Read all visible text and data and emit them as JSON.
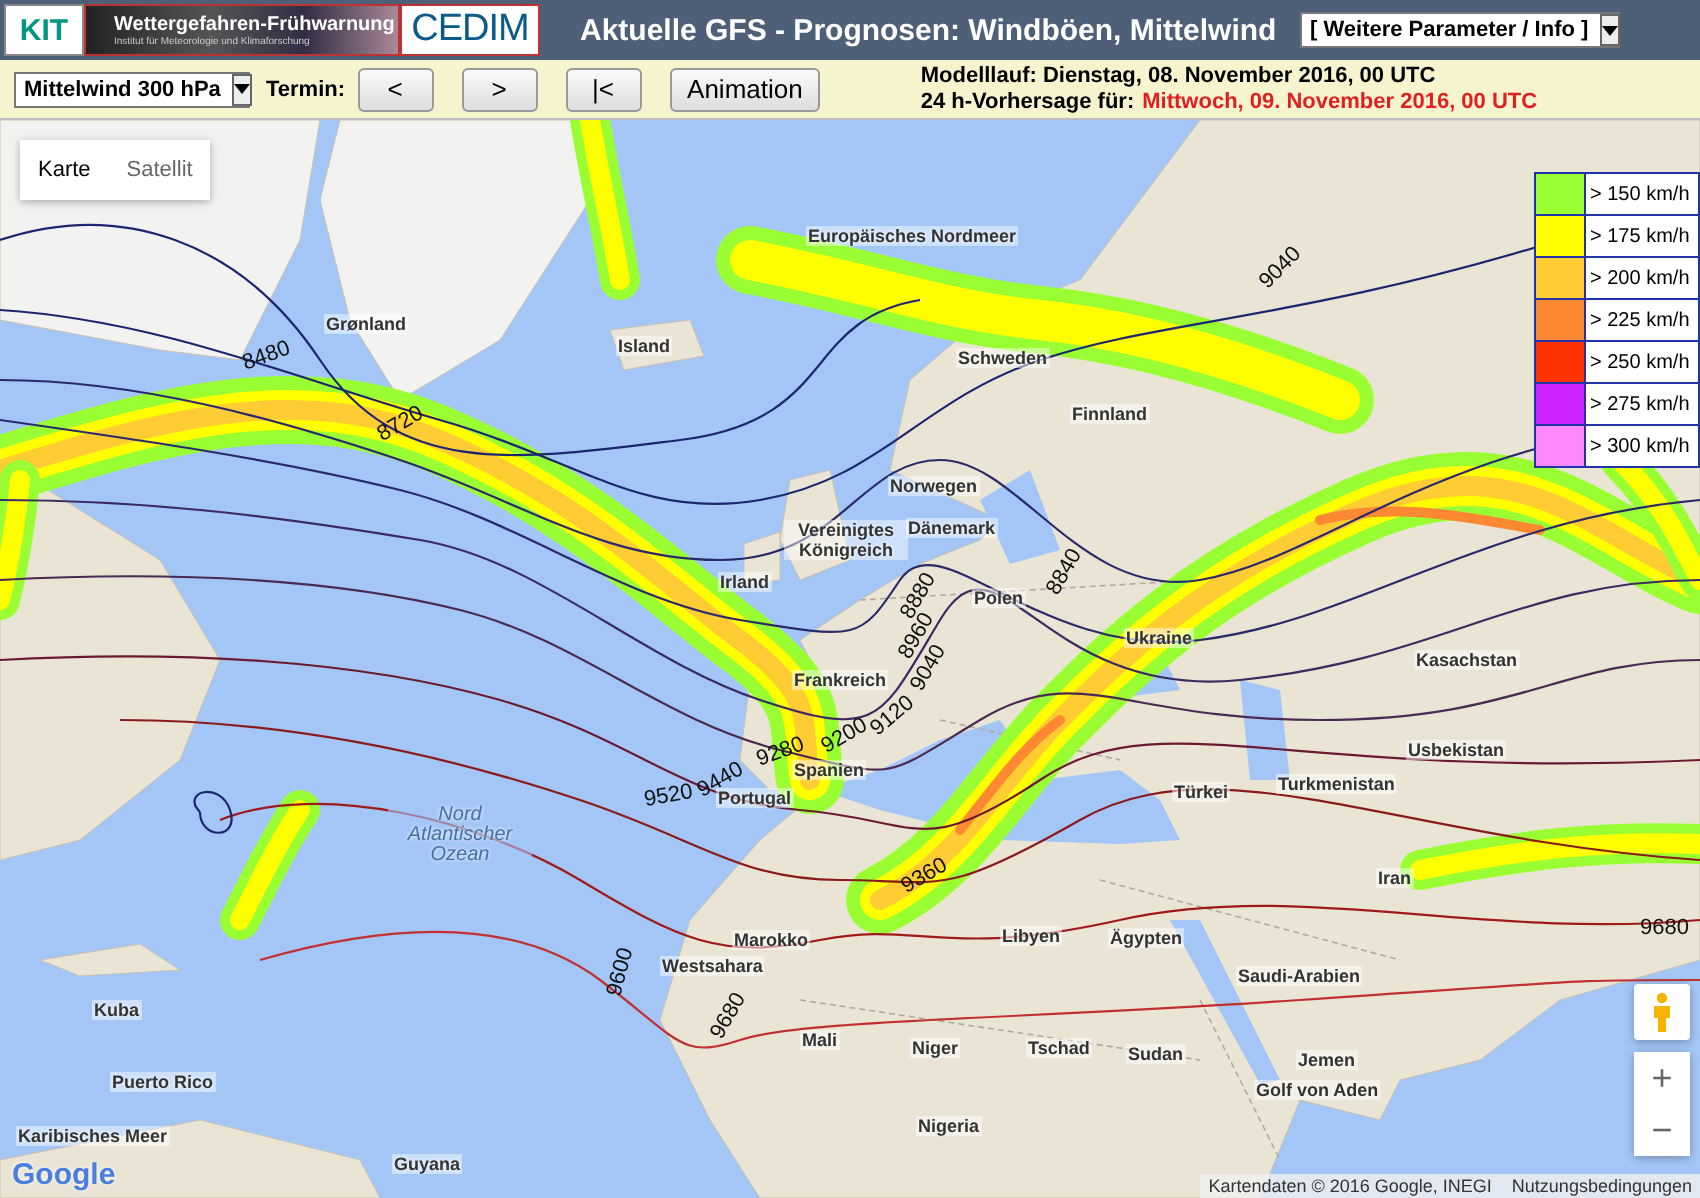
{
  "header": {
    "logo": "KIT",
    "banner_title": "Wettergefahren-Frühwarnung",
    "banner_subtitle": "Institut für Meteorologie und Klimaforschung",
    "partner_logo": "CEDIM",
    "title": "Aktuelle GFS - Prognosen: Windböen, Mittelwind",
    "parameter_select": "[ Weitere Parameter / Info ]"
  },
  "toolbar": {
    "level_select": "Mittelwind 300 hPa",
    "termin_label": "Termin:",
    "buttons": [
      "<",
      ">",
      "|<",
      "Animation"
    ],
    "model_run": "Modelllauf: Dienstag, 08. November 2016, 00 UTC",
    "forecast_label": "24 h-Vorhersage für:",
    "forecast_date": "Mittwoch, 09. November 2016, 00 UTC"
  },
  "map": {
    "map_types": [
      {
        "label": "Karte",
        "selected": true
      },
      {
        "label": "Satellit",
        "selected": false
      }
    ],
    "legend": [
      {
        "label": "> 150 km/h",
        "color": "#99ff33"
      },
      {
        "label": "> 175 km/h",
        "color": "#ffff00"
      },
      {
        "label": "> 200 km/h",
        "color": "#ffcc33"
      },
      {
        "label": "> 225 km/h",
        "color": "#ff8833"
      },
      {
        "label": "> 250 km/h",
        "color": "#ff3300"
      },
      {
        "label": "> 275 km/h",
        "color": "#cc22ff"
      },
      {
        "label": "> 300 km/h",
        "color": "#ff88ff"
      }
    ],
    "place_labels": [
      "Grønland",
      "Island",
      "Europäisches Nordmeer",
      "Schweden",
      "Finnland",
      "Norwegen",
      "Dänemark",
      "Vereinigtes Königreich",
      "Irland",
      "Polen",
      "Ukraine",
      "Kasachstan",
      "Frankreich",
      "Spanien",
      "Portugal",
      "Marokko",
      "Libyen",
      "Ägypten",
      "Türkei",
      "Turkmenistan",
      "Usbekistan",
      "Iran",
      "Saudi-Arabien",
      "Westsahara",
      "Mali",
      "Niger",
      "Tschad",
      "Sudan",
      "Jemen",
      "Nigeria",
      "Nord Atlantischer Ozean",
      "Kuba",
      "Puerto Rico",
      "Karibisches Meer",
      "Guyana",
      "Golf von Aden"
    ],
    "contour_labels": [
      "8480",
      "8720",
      "9040",
      "8880",
      "8960",
      "8840",
      "9040",
      "9120",
      "9200",
      "9280",
      "9440",
      "9520",
      "9360",
      "9600",
      "9680",
      "9680"
    ],
    "attribution": "Kartendaten © 2016 Google, INEGI",
    "terms": "Nutzungsbedingungen",
    "google_logo": "Google",
    "zoom_in": "+",
    "zoom_out": "−"
  }
}
